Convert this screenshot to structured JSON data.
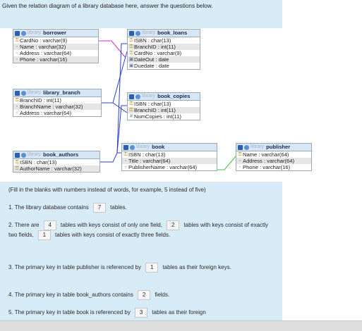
{
  "intro": "Given the relation diagram of a library database here, answer the questions below.",
  "tables": {
    "prefix": "library",
    "borrower": {
      "name": "borrower",
      "fields": [
        "CardNo : varchar(9)",
        "Name : varchar(32)",
        "Address : varchar(64)",
        "Phone : varchar(16)"
      ]
    },
    "book_loans": {
      "name": "book_loans",
      "fields": [
        "ISBN : char(13)",
        "BranchID : int(11)",
        "CardNo : varchar(9)",
        "DateOut : date",
        "Duedate : date"
      ]
    },
    "library_branch": {
      "name": "library_branch",
      "fields": [
        "BranchID : int(11)",
        "BranchName : varchar(32)",
        "Address : varchar(64)"
      ]
    },
    "book_copies": {
      "name": "book_copies",
      "fields": [
        "ISBN : char(13)",
        "BranchID : int(11)",
        "NumCopies : int(11)"
      ]
    },
    "book_authors": {
      "name": "book_authors",
      "fields": [
        "ISBN : char(13)",
        "AuthorName : varchar(32)"
      ]
    },
    "book": {
      "name": "book",
      "fields": [
        "ISBN : char(13)",
        "Title : varchar(64)",
        "PublisherName : varchar(64)"
      ]
    },
    "publisher": {
      "name": "publisher",
      "fields": [
        "Name : varchar(64)",
        "Address : varchar(64)",
        "Phone : varchar(16)"
      ]
    }
  },
  "colors": {
    "panel": "#d8ecf7",
    "header": "#d7e6f5",
    "link_blue": "#2a3fd0",
    "link_magenta": "#d22bc8",
    "link_green": "#3cc43c"
  },
  "instructions": "(Fill in the blanks with numbers instead of words, for example, 5 instead of five)",
  "questions": {
    "q1": {
      "before": "1. The library database contains",
      "answer": "7",
      "after": "tables."
    },
    "q2": {
      "before": "2. There are",
      "answer1": "4",
      "mid1": "tables with keys consist of only one field,",
      "answer2": "2",
      "mid2": "tables with keys consist of exactly two fields,",
      "answer3": "1",
      "after": "tables with keys consist of exactly three fields."
    },
    "q3": {
      "before": "3. The primary key in table publisher is referenced by",
      "answer": "1",
      "after": "tables as their foreign keys."
    },
    "q4": {
      "before": "4. The primary key in table book_authors contains",
      "answer": "2",
      "after": "fields."
    },
    "q5": {
      "before": "5. The primary key in table book is referenced by",
      "answer": "3",
      "after": "tables as their foreign"
    }
  }
}
